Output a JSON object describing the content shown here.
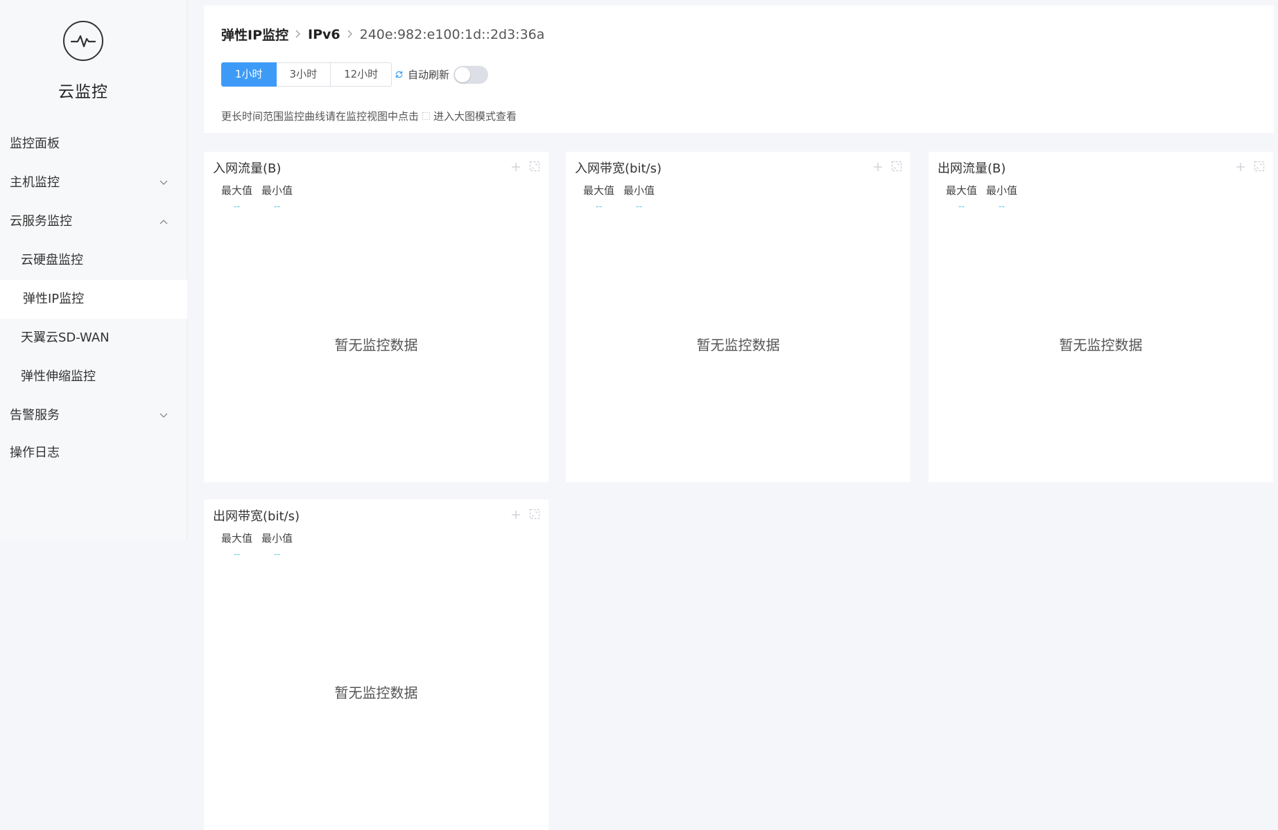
{
  "app": {
    "title": "云监控",
    "logo_icon": "pulse-circle-icon"
  },
  "sidebar": {
    "items": [
      {
        "label": "监控面板"
      },
      {
        "label": "主机监控",
        "chevron": "down"
      },
      {
        "label": "云服务监控",
        "chevron": "up"
      },
      {
        "label": "云硬盘监控"
      },
      {
        "label": "弹性IP监控",
        "active": true
      },
      {
        "label": "天翼云SD-WAN"
      },
      {
        "label": "弹性伸缩监控"
      },
      {
        "label": "告警服务",
        "chevron": "down"
      },
      {
        "label": "操作日志"
      }
    ]
  },
  "breadcrumb": {
    "level1": "弹性IP监控",
    "level2": "IPv6",
    "level3": "240e:982:e100:1d::2d3:36a"
  },
  "time_range": {
    "options": [
      "1小时",
      "3小时",
      "12小时"
    ],
    "selected": "1小时"
  },
  "auto_refresh": {
    "label": "自动刷新",
    "enabled": false
  },
  "hint": {
    "before": "更长时间范围监控曲线请在监控视图中点击",
    "after": "进入大图模式查看"
  },
  "charts": [
    {
      "title": "入网流量(B)",
      "max_label": "最大值",
      "min_label": "最小值",
      "max_value": "--",
      "min_value": "--",
      "empty_text": "暂无监控数据"
    },
    {
      "title": "入网带宽(bit/s)",
      "max_label": "最大值",
      "min_label": "最小值",
      "max_value": "--",
      "min_value": "--",
      "empty_text": "暂无监控数据"
    },
    {
      "title": "出网流量(B)",
      "max_label": "最大值",
      "min_label": "最小值",
      "max_value": "--",
      "min_value": "--",
      "empty_text": "暂无监控数据"
    },
    {
      "title": "出网带宽(bit/s)",
      "max_label": "最大值",
      "min_label": "最小值",
      "max_value": "--",
      "min_value": "--",
      "empty_text": "暂无监控数据"
    }
  ],
  "colors": {
    "accent": "#3d9bf7",
    "stat_value": "#5ac8e0",
    "page_bg": "#f5f6fa"
  }
}
